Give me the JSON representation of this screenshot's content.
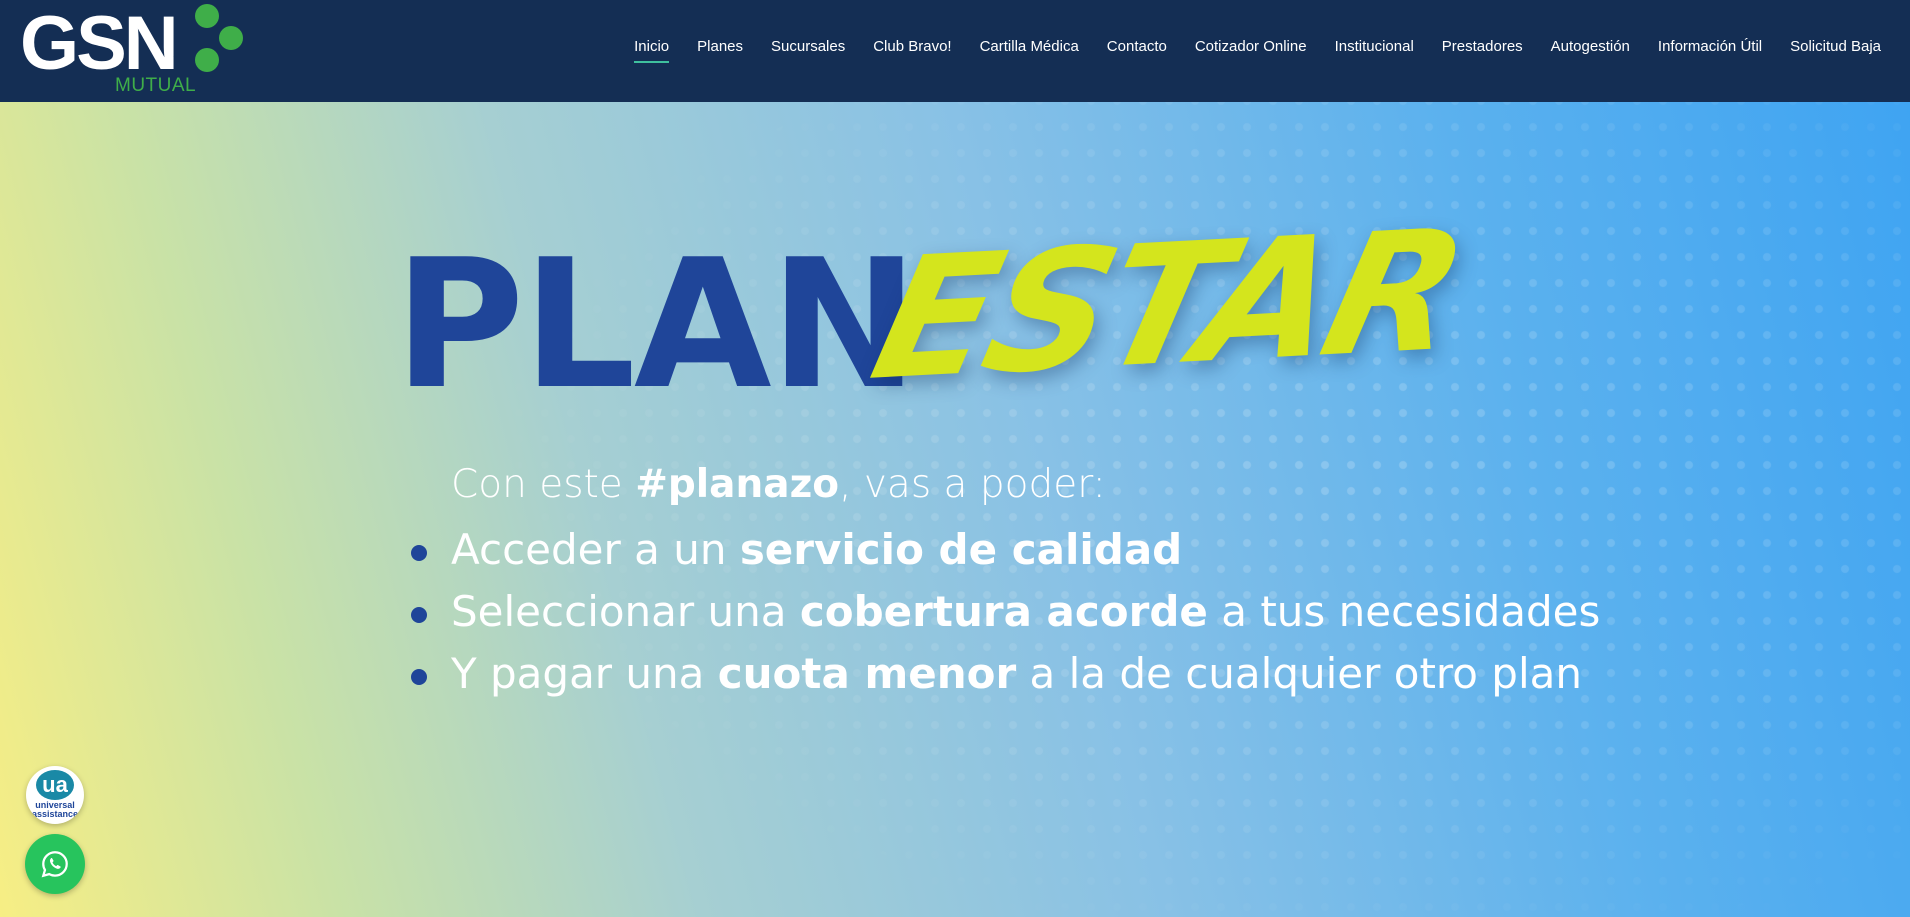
{
  "header": {
    "logo": {
      "text": "GSN",
      "subtext": "MUTUAL"
    },
    "nav": [
      {
        "label": "Inicio",
        "active": true
      },
      {
        "label": "Planes"
      },
      {
        "label": "Sucursales"
      },
      {
        "label": "Club Bravo!"
      },
      {
        "label": "Cartilla Médica"
      },
      {
        "label": "Contacto"
      },
      {
        "label": "Cotizador Online"
      },
      {
        "label": "Institucional"
      },
      {
        "label": "Prestadores"
      },
      {
        "label": "Autogestión"
      },
      {
        "label": "Información Útil"
      },
      {
        "label": "Solicitud Baja"
      }
    ]
  },
  "hero": {
    "title_part1": "PLAN",
    "title_part2": "ESTAR",
    "intro": {
      "pre": "Con este ",
      "bold": "#planazo",
      "post": ", vas a poder:"
    },
    "bullets": [
      {
        "pre": "Acceder a un ",
        "bold": "servicio de calidad",
        "post": ""
      },
      {
        "pre": "Seleccionar una ",
        "bold": "cobertura acorde",
        "post": " a tus necesidades"
      },
      {
        "pre": "Y pagar una ",
        "bold": "cuota menor",
        "post": " a la de cualquier otro plan"
      }
    ]
  },
  "floating": {
    "universal_assistance": {
      "mark": "ua",
      "text_line1": "universal",
      "text_line2": "assistance",
      "icon": "universal-assistance-logo"
    },
    "whatsapp": {
      "icon": "whatsapp-icon"
    }
  },
  "colors": {
    "header_bg": "#142e54",
    "brand_green": "#3fae49",
    "title_blue": "#1f4599",
    "title_lime": "#d4e51d",
    "whatsapp_green": "#27c45d"
  }
}
